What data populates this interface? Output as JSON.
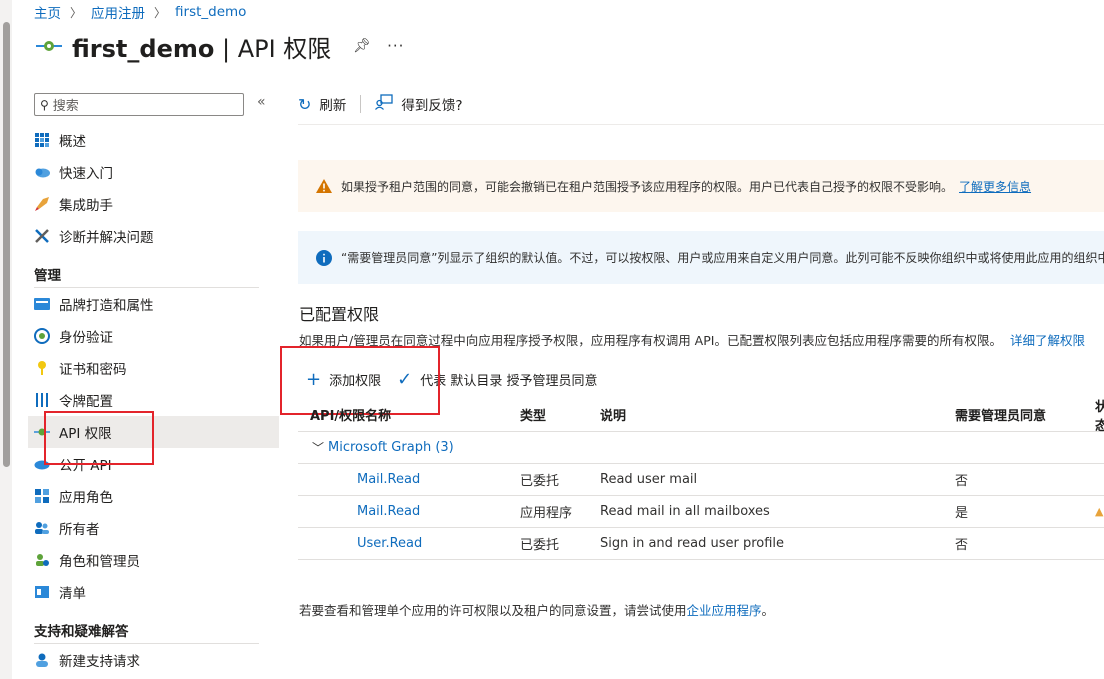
{
  "breadcrumb": {
    "home": "主页",
    "app_reg": "应用注册",
    "app": "first_demo"
  },
  "page": {
    "title_main": "first_demo",
    "title_sub": " | API 权限"
  },
  "sidebar": {
    "search_placeholder": "搜索",
    "items_top": [
      {
        "label": "概述",
        "icon": "grid-icon"
      },
      {
        "label": "快速入门",
        "icon": "cloud-icon"
      },
      {
        "label": "集成助手",
        "icon": "rocket-icon"
      },
      {
        "label": "诊断并解决问题",
        "icon": "wrench-icon"
      }
    ],
    "section_manage": "管理",
    "items_manage": [
      {
        "label": "品牌打造和属性",
        "icon": "branding-icon"
      },
      {
        "label": "身份验证",
        "icon": "auth-icon"
      },
      {
        "label": "证书和密码",
        "icon": "key-icon"
      },
      {
        "label": "令牌配置",
        "icon": "token-icon"
      },
      {
        "label": "API 权限",
        "icon": "api-icon"
      },
      {
        "label": "公开 API",
        "icon": "cloud-api-icon"
      },
      {
        "label": "应用角色",
        "icon": "app-roles-icon"
      },
      {
        "label": "所有者",
        "icon": "owners-icon"
      },
      {
        "label": "角色和管理员",
        "icon": "roles-admin-icon"
      },
      {
        "label": "清单",
        "icon": "manifest-icon"
      }
    ],
    "section_support": "支持和疑难解答",
    "items_support": [
      {
        "label": "新建支持请求",
        "icon": "support-icon"
      }
    ]
  },
  "toolbar": {
    "refresh": "刷新",
    "feedback": "得到反馈?"
  },
  "banners": {
    "warning": "如果授予租户范围的同意，可能会撤销已在租户范围授予该应用程序的权限。用户已代表自己授予的权限不受影响。",
    "warning_link": "了解更多信息",
    "info": "“需要管理员同意”列显示了组织的默认值。不过，可以按权限、用户或应用来自定义用户同意。此列可能不反映你组织中或将使用此应用的组织中"
  },
  "configured": {
    "title": "已配置权限",
    "desc": "如果用户/管理员在同意过程中向应用程序授予权限，应用程序有权调用 API。已配置权限列表应包括应用程序需要的所有权限。",
    "desc_link": "详细了解权限",
    "add_permission": "添加权限",
    "grant_consent": "代表 默认目录 授予管理员同意"
  },
  "table": {
    "headers": [
      "API/权限名称",
      "类型",
      "说明",
      "需要管理员同意",
      "状态"
    ],
    "group": "Microsoft Graph (3)",
    "rows": [
      {
        "name": "Mail.Read",
        "type": "已委托",
        "desc": "Read user mail",
        "admin": "否"
      },
      {
        "name": "Mail.Read",
        "type": "应用程序",
        "desc": "Read mail in all mailboxes",
        "admin": "是"
      },
      {
        "name": "User.Read",
        "type": "已委托",
        "desc": "Sign in and read user profile",
        "admin": "否"
      }
    ]
  },
  "footer": {
    "text": "若要查看和管理单个应用的许可权限以及租户的同意设置，请尝试使用",
    "link": "企业应用程序",
    "end": "。"
  },
  "colors": {
    "accent": "#0f6cbd",
    "highlight": "#e3242b",
    "warning": "#d47500",
    "info": "#0f6cbd"
  }
}
